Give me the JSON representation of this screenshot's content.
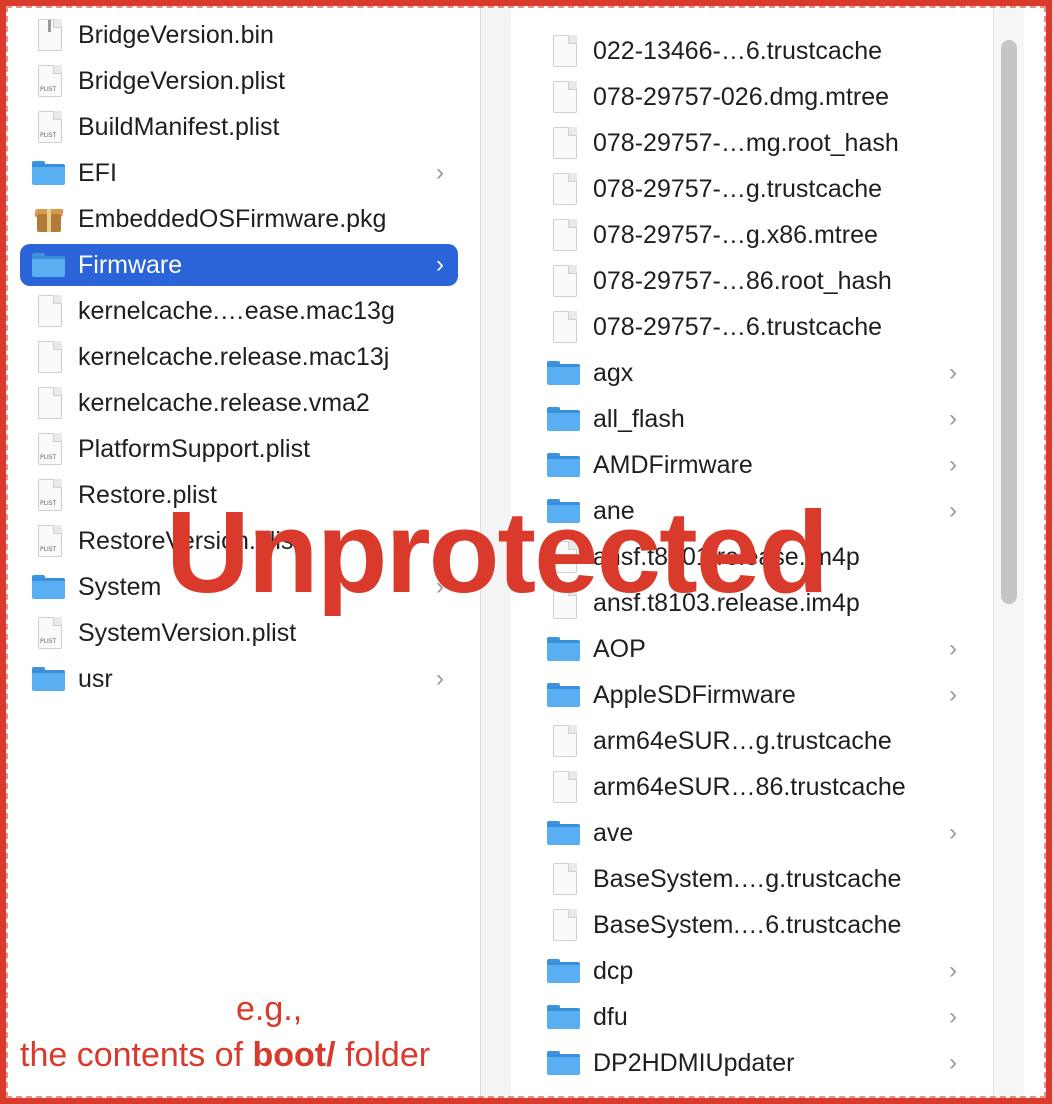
{
  "left_column": {
    "items": [
      {
        "name": "BridgeVersion.bin",
        "kind": "zipdoc",
        "folder": false,
        "selected": false
      },
      {
        "name": "BridgeVersion.plist",
        "kind": "plist",
        "folder": false,
        "selected": false
      },
      {
        "name": "BuildManifest.plist",
        "kind": "plist",
        "folder": false,
        "selected": false
      },
      {
        "name": "EFI",
        "kind": "folder",
        "folder": true,
        "selected": false
      },
      {
        "name": "EmbeddedOSFirmware.pkg",
        "kind": "package",
        "folder": false,
        "selected": false
      },
      {
        "name": "Firmware",
        "kind": "folder",
        "folder": true,
        "selected": true
      },
      {
        "name": "kernelcache.…ease.mac13g",
        "kind": "doc",
        "folder": false,
        "selected": false
      },
      {
        "name": "kernelcache.release.mac13j",
        "kind": "doc",
        "folder": false,
        "selected": false
      },
      {
        "name": "kernelcache.release.vma2",
        "kind": "doc",
        "folder": false,
        "selected": false
      },
      {
        "name": "PlatformSupport.plist",
        "kind": "plist",
        "folder": false,
        "selected": false
      },
      {
        "name": "Restore.plist",
        "kind": "plist",
        "folder": false,
        "selected": false
      },
      {
        "name": "RestoreVersion.plist",
        "kind": "plist",
        "folder": false,
        "selected": false
      },
      {
        "name": "System",
        "kind": "folder",
        "folder": true,
        "selected": false
      },
      {
        "name": "SystemVersion.plist",
        "kind": "plist",
        "folder": false,
        "selected": false
      },
      {
        "name": "usr",
        "kind": "folder",
        "folder": true,
        "selected": false
      }
    ]
  },
  "right_column": {
    "items": [
      {
        "name": "022-13466-…6.trustcache",
        "kind": "doc",
        "folder": false
      },
      {
        "name": "078-29757-026.dmg.mtree",
        "kind": "doc",
        "folder": false
      },
      {
        "name": "078-29757-…mg.root_hash",
        "kind": "doc",
        "folder": false
      },
      {
        "name": "078-29757-…g.trustcache",
        "kind": "doc",
        "folder": false
      },
      {
        "name": "078-29757-…g.x86.mtree",
        "kind": "doc",
        "folder": false
      },
      {
        "name": "078-29757-…86.root_hash",
        "kind": "doc",
        "folder": false
      },
      {
        "name": "078-29757-…6.trustcache",
        "kind": "doc",
        "folder": false
      },
      {
        "name": "agx",
        "kind": "folder",
        "folder": true
      },
      {
        "name": "all_flash",
        "kind": "folder",
        "folder": true
      },
      {
        "name": "AMDFirmware",
        "kind": "folder",
        "folder": true
      },
      {
        "name": "ane",
        "kind": "folder",
        "folder": true
      },
      {
        "name": "ansf.t8101.release.im4p",
        "kind": "doc",
        "folder": false
      },
      {
        "name": "ansf.t8103.release.im4p",
        "kind": "doc",
        "folder": false
      },
      {
        "name": "AOP",
        "kind": "folder",
        "folder": true
      },
      {
        "name": "AppleSDFirmware",
        "kind": "folder",
        "folder": true
      },
      {
        "name": "arm64eSUR…g.trustcache",
        "kind": "doc",
        "folder": false
      },
      {
        "name": "arm64eSUR…86.trustcache",
        "kind": "doc",
        "folder": false
      },
      {
        "name": "ave",
        "kind": "folder",
        "folder": true
      },
      {
        "name": "BaseSystem.…g.trustcache",
        "kind": "doc",
        "folder": false
      },
      {
        "name": "BaseSystem.…6.trustcache",
        "kind": "doc",
        "folder": false
      },
      {
        "name": "dcp",
        "kind": "folder",
        "folder": true
      },
      {
        "name": "dfu",
        "kind": "folder",
        "folder": true
      },
      {
        "name": "DP2HDMIUpdater",
        "kind": "folder",
        "folder": true
      }
    ]
  },
  "overlay": {
    "stamp": "Unprotected",
    "note_line1": "e.g.,",
    "note_line2_prefix": "the contents of ",
    "note_line2_bold": "boot/",
    "note_line2_suffix": " folder"
  },
  "icons": {
    "chevron": "›",
    "plist_tag": "PLIST"
  },
  "colors": {
    "selection": "#2b63d9",
    "annotation": "#d93a2b",
    "folder": "#5aaef2"
  }
}
